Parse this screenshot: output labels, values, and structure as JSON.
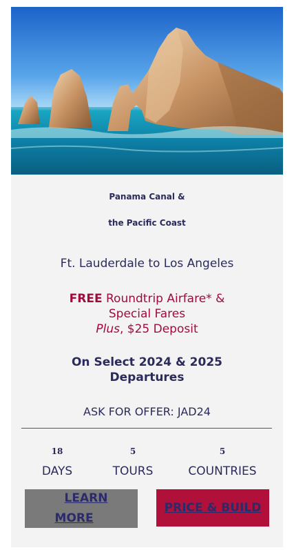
{
  "hero": {
    "image_alt": "rock-arch-sea-image"
  },
  "tour": {
    "title_line1": "Panama Canal &",
    "title_line2": "the Pacific Coast",
    "route": "Ft. Lauderdale to Los Angeles"
  },
  "offer": {
    "free": "FREE",
    "line1_rest": " Roundtrip Airfare* &",
    "line2": "Special Fares",
    "plus": "Plus",
    "line3_rest": ", $25 Deposit",
    "departures_line1": "On Select 2024 & 2025",
    "departures_line2": "Departures",
    "code": "ASK FOR OFFER: JAD24"
  },
  "stats": [
    {
      "value": "18",
      "label": "DAYS"
    },
    {
      "value": "5",
      "label": "TOURS"
    },
    {
      "value": "5",
      "label": "COUNTRIES"
    }
  ],
  "buttons": {
    "learn_more_line1": "LEARN",
    "learn_more_line2": "MORE",
    "price_build": "PRICE & BUILD"
  },
  "colors": {
    "navy_text": "#2b2b5b",
    "offer_red": "#a10b3a",
    "price_button": "#b0103a",
    "learn_button": "#7a7a7a",
    "card_bg": "#f3f3f3"
  }
}
